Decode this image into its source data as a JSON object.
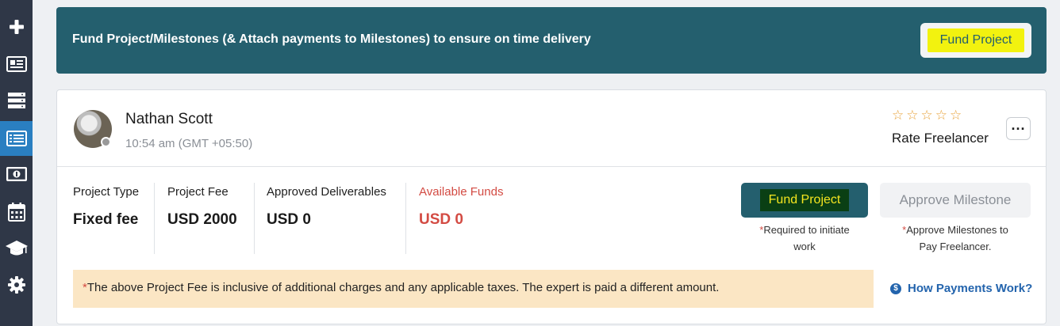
{
  "sidebar": {
    "items": [
      {
        "icon": "plus-icon"
      },
      {
        "icon": "newspaper-icon"
      },
      {
        "icon": "server-icon"
      },
      {
        "icon": "list-icon",
        "active": true
      },
      {
        "icon": "money-icon"
      },
      {
        "icon": "calendar-icon"
      },
      {
        "icon": "graduation-cap-icon"
      },
      {
        "icon": "gear-icon"
      }
    ]
  },
  "banner": {
    "text": "Fund Project/Milestones (& Attach payments to Milestones) to ensure on time delivery",
    "button_label": "Fund Project"
  },
  "freelancer": {
    "name": "Nathan Scott",
    "time": "10:54 am (GMT +05:50)",
    "stars": "☆☆☆☆☆",
    "rate_label": "Rate Freelancer",
    "more_label": "···"
  },
  "project": {
    "type_label": "Project Type",
    "type_value": "Fixed fee",
    "fee_label": "Project Fee",
    "fee_value": "USD 2000",
    "deliverables_label": "Approved Deliverables",
    "deliverables_value": "USD 0",
    "funds_label": "Available Funds",
    "funds_value": "USD 0"
  },
  "actions": {
    "fund_label": "Fund Project",
    "fund_note_line1": "Required to initiate",
    "fund_note_line2": "work",
    "approve_label": "Approve Milestone",
    "approve_note_line1": "Approve Milestones to",
    "approve_note_line2": "Pay Freelancer."
  },
  "disclaimer": {
    "asterisk": "*",
    "text": "The above Project Fee is inclusive of additional charges and any applicable taxes. The expert is paid a different amount."
  },
  "help_link": {
    "label": "How Payments Work?"
  },
  "colors": {
    "banner": "#245f6e",
    "sidebar": "#2f3747",
    "sidebar_active": "#2a7fc1",
    "highlight": "#f2f20f",
    "available_funds": "#d34b43",
    "link": "#2364ad"
  }
}
